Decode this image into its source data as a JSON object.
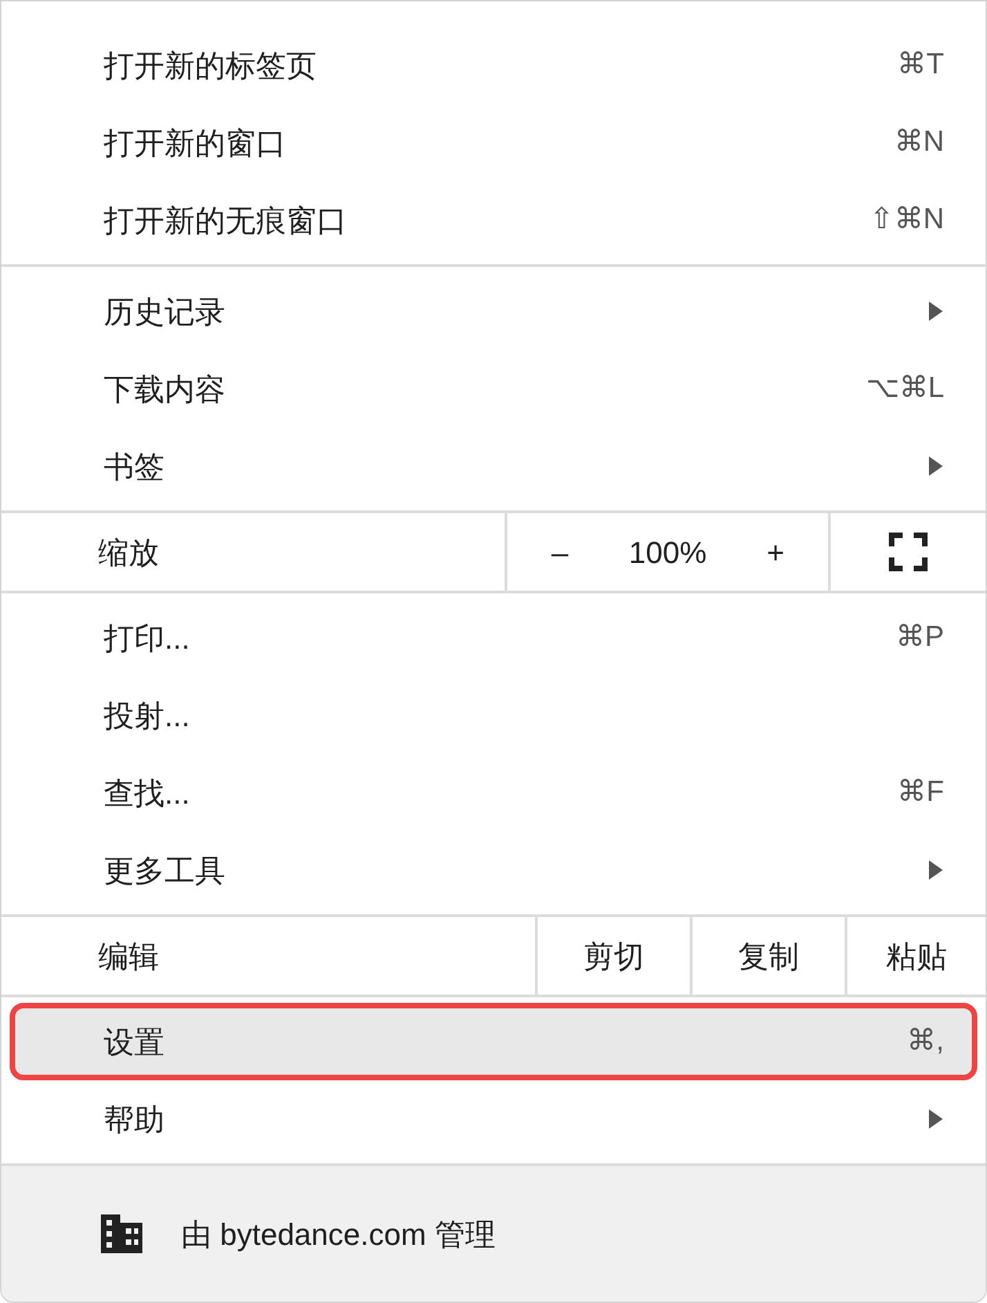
{
  "sections": [
    {
      "kind": "group",
      "items": [
        {
          "label": "打开新的标签页",
          "shortcut": "⌘T",
          "submenu": false,
          "selected": false
        },
        {
          "label": "打开新的窗口",
          "shortcut": "⌘N",
          "submenu": false,
          "selected": false
        },
        {
          "label": "打开新的无痕窗口",
          "shortcut": "⇧⌘N",
          "submenu": false,
          "selected": false
        }
      ]
    },
    {
      "kind": "group",
      "items": [
        {
          "label": "历史记录",
          "submenu": true,
          "selected": false
        },
        {
          "label": "下载内容",
          "shortcut": "⌥⌘L",
          "submenu": false,
          "selected": false
        },
        {
          "label": "书签",
          "submenu": true,
          "selected": false
        }
      ]
    },
    {
      "kind": "zoom",
      "label": "缩放",
      "minus": "–",
      "value": "100%",
      "plus": "+"
    },
    {
      "kind": "group",
      "items": [
        {
          "label": "打印...",
          "shortcut": "⌘P",
          "submenu": false,
          "selected": false
        },
        {
          "label": "投射...",
          "submenu": false,
          "selected": false
        },
        {
          "label": "查找...",
          "shortcut": "⌘F",
          "submenu": false,
          "selected": false
        },
        {
          "label": "更多工具",
          "submenu": true,
          "selected": false
        }
      ]
    },
    {
      "kind": "edit",
      "label": "编辑",
      "buttons": [
        "剪切",
        "复制",
        "粘贴"
      ]
    },
    {
      "kind": "group",
      "items": [
        {
          "label": "设置",
          "shortcut": "⌘,",
          "submenu": false,
          "selected": true
        },
        {
          "label": "帮助",
          "submenu": true,
          "selected": false
        }
      ]
    }
  ],
  "footer": {
    "text": "由 bytedance.com 管理"
  }
}
